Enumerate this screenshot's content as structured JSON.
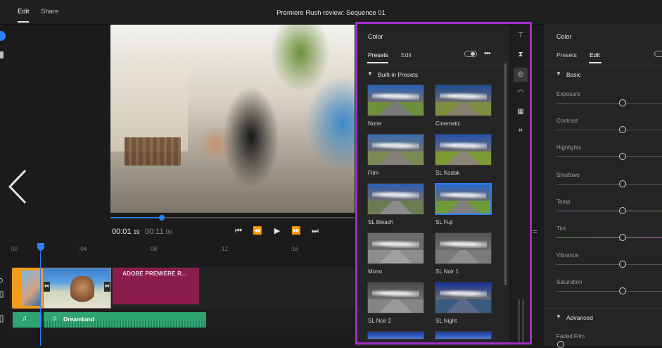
{
  "app": {
    "title": "Premiere Rush review: Sequence 01",
    "tabs": [
      {
        "label": "Edit"
      },
      {
        "label": "Share"
      }
    ]
  },
  "player": {
    "current_time": "00:01",
    "current_frames": "19",
    "total_time": "00:11",
    "total_frames": "00",
    "progress": 0.21,
    "controls": {
      "skip_start": "⏮",
      "step_back": "⏪",
      "play": "▶",
      "step_forward": "⏩",
      "skip_end": "⏭"
    }
  },
  "timeline": {
    "ticks": [
      "00",
      ":04",
      ":08",
      ":12",
      ":16"
    ],
    "title_clip_label": "ADOBE PREMIERE R...",
    "audio_clip_label": "Dreamland"
  },
  "presets_panel": {
    "title": "Color",
    "tabs": [
      {
        "label": "Presets"
      },
      {
        "label": "Edit"
      }
    ],
    "section": "Built-in Presets",
    "presets": [
      {
        "label": "None",
        "sky": "#2b62b8",
        "land": "#6e8f3b",
        "road": "#7a7a7a"
      },
      {
        "label": "Cinematic",
        "sky": "#1f4a96",
        "land": "#7d8f3e",
        "road": "#8a7f6e"
      },
      {
        "label": "Film",
        "sky": "#3a6fae",
        "land": "#7b8a55",
        "road": "#85807a"
      },
      {
        "label": "SL Kodak",
        "sky": "#2350b0",
        "land": "#7c9a34",
        "road": "#8a8478"
      },
      {
        "label": "SL Bleach",
        "sky": "#2f5cb0",
        "land": "#6b7d50",
        "road": "#8a8a8a"
      },
      {
        "label": "SL Fuji",
        "sky": "#2a66c4",
        "land": "#6f9a3a",
        "road": "#7f7f7f"
      },
      {
        "label": "Mono",
        "sky": "#6a6a6a",
        "land": "#8d8d8d",
        "road": "#a0a0a0"
      },
      {
        "label": "SL Noir 1",
        "sky": "#555555",
        "land": "#7a7a7a",
        "road": "#8e8e8e"
      },
      {
        "label": "SL Noir 2",
        "sky": "#4a4a4a",
        "land": "#858585",
        "road": "#9a9a9a"
      },
      {
        "label": "SL Night",
        "sky": "#16309a",
        "land": "#3a5a80",
        "road": "#5a6a88"
      }
    ],
    "selected_index": 5
  },
  "edit_panel": {
    "title": "Color",
    "tabs": [
      {
        "label": "Presets"
      },
      {
        "label": "Edit"
      }
    ],
    "basic_section": "Basic",
    "sliders": [
      {
        "label": "Exposure",
        "value": 0.5
      },
      {
        "label": "Contrast",
        "value": 0.5
      },
      {
        "label": "Highlights",
        "value": 0.5
      },
      {
        "label": "Shadows",
        "value": 0.5
      },
      {
        "label": "Temp",
        "value": 0.5
      },
      {
        "label": "Tint",
        "value": 0.5
      },
      {
        "label": "Vibrance",
        "value": 0.5
      },
      {
        "label": "Saturation",
        "value": 0.5
      }
    ],
    "advanced_section": "Advanced",
    "faded_film_label": "Faded Film",
    "faded_film_value": 0
  },
  "colors": {
    "accent": "#2d7ff9",
    "highlight": "#a12ec9",
    "title_clip": "#8b1d4d",
    "audio_clip": "#2fa372"
  }
}
